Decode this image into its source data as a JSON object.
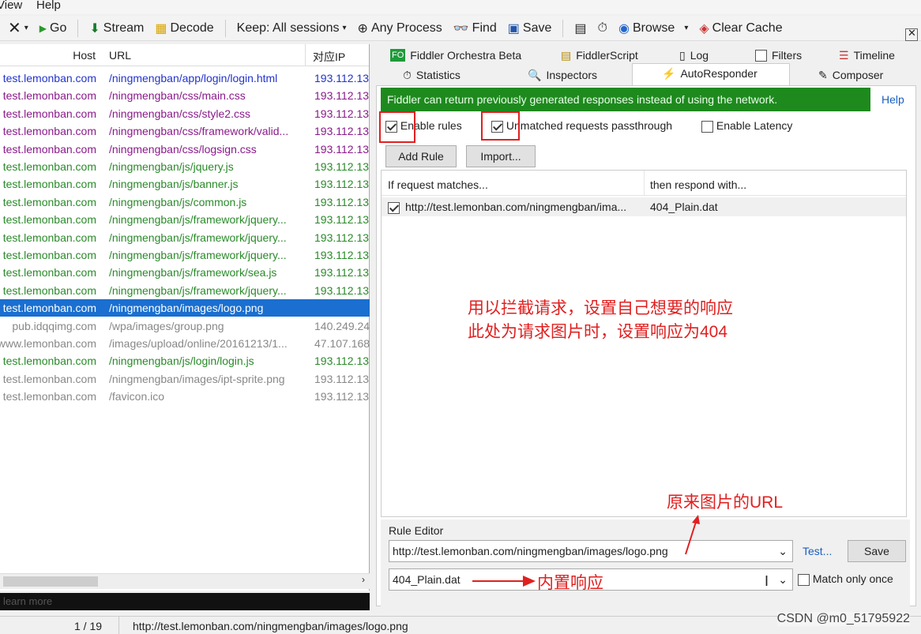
{
  "menu": {
    "view": "View",
    "help": "Help"
  },
  "toolbar": {
    "go": "Go",
    "stream": "Stream",
    "decode": "Decode",
    "keep": "Keep: All sessions",
    "any_process": "Any Process",
    "find": "Find",
    "save": "Save",
    "browse": "Browse",
    "clear_cache": "Clear Cache"
  },
  "sessions": {
    "columns": {
      "host": "Host",
      "url": "URL",
      "ip": "对应IP"
    },
    "rows": [
      {
        "host": "test.lemonban.com",
        "url": "/ningmengban/app/login/login.html",
        "ip": "193.112.13",
        "color": "#2233cc"
      },
      {
        "host": "test.lemonban.com",
        "url": "/ningmengban/css/main.css",
        "ip": "193.112.13",
        "color": "#8a1a8a"
      },
      {
        "host": "test.lemonban.com",
        "url": "/ningmengban/css/style2.css",
        "ip": "193.112.13",
        "color": "#8a1a8a"
      },
      {
        "host": "test.lemonban.com",
        "url": "/ningmengban/css/framework/valid...",
        "ip": "193.112.13",
        "color": "#8a1a8a"
      },
      {
        "host": "test.lemonban.com",
        "url": "/ningmengban/css/logsign.css",
        "ip": "193.112.13",
        "color": "#8a1a8a"
      },
      {
        "host": "test.lemonban.com",
        "url": "/ningmengban/js/jquery.js",
        "ip": "193.112.13",
        "color": "#2a8a2a"
      },
      {
        "host": "test.lemonban.com",
        "url": "/ningmengban/js/banner.js",
        "ip": "193.112.13",
        "color": "#2a8a2a"
      },
      {
        "host": "test.lemonban.com",
        "url": "/ningmengban/js/common.js",
        "ip": "193.112.13",
        "color": "#2a8a2a"
      },
      {
        "host": "test.lemonban.com",
        "url": "/ningmengban/js/framework/jquery...",
        "ip": "193.112.13",
        "color": "#2a8a2a"
      },
      {
        "host": "test.lemonban.com",
        "url": "/ningmengban/js/framework/jquery...",
        "ip": "193.112.13",
        "color": "#2a8a2a"
      },
      {
        "host": "test.lemonban.com",
        "url": "/ningmengban/js/framework/jquery...",
        "ip": "193.112.13",
        "color": "#2a8a2a"
      },
      {
        "host": "test.lemonban.com",
        "url": "/ningmengban/js/framework/sea.js",
        "ip": "193.112.13",
        "color": "#2a8a2a"
      },
      {
        "host": "test.lemonban.com",
        "url": "/ningmengban/js/framework/jquery...",
        "ip": "193.112.13",
        "color": "#2a8a2a"
      },
      {
        "host": "test.lemonban.com",
        "url": "/ningmengban/images/logo.png",
        "ip": "",
        "color": "#ffffff",
        "selected": true
      },
      {
        "host": "pub.idqqimg.com",
        "url": "/wpa/images/group.png",
        "ip": "140.249.24",
        "color": "#888888"
      },
      {
        "host": "www.lemonban.com",
        "url": "/images/upload/online/20161213/1...",
        "ip": "47.107.168",
        "color": "#888888"
      },
      {
        "host": "test.lemonban.com",
        "url": "/ningmengban/js/login/login.js",
        "ip": "193.112.13",
        "color": "#2a8a2a"
      },
      {
        "host": "test.lemonban.com",
        "url": "/ningmengban/images/ipt-sprite.png",
        "ip": "193.112.13",
        "color": "#888888"
      },
      {
        "host": "test.lemonban.com",
        "url": "/favicon.ico",
        "ip": "193.112.13",
        "color": "#888888"
      }
    ]
  },
  "learn_more": "learn more",
  "status": {
    "count": "1 / 19",
    "url": "http://test.lemonban.com/ningmengban/images/logo.png"
  },
  "tabs": {
    "orchestra": "Fiddler Orchestra Beta",
    "script": "FiddlerScript",
    "log": "Log",
    "filters": "Filters",
    "timeline": "Timeline",
    "statistics": "Statistics",
    "inspectors": "Inspectors",
    "autoresponder": "AutoResponder",
    "composer": "Composer"
  },
  "autoresponder": {
    "banner": "Fiddler can return previously generated responses instead of using the network.",
    "help": "Help",
    "enable_rules": "Enable rules",
    "unmatched": "Unmatched requests passthrough",
    "latency": "Enable Latency",
    "add_rule": "Add Rule",
    "import": "Import...",
    "col_match": "If request matches...",
    "col_respond": "then respond with...",
    "rule": {
      "match": "http://test.lemonban.com/ningmengban/ima...",
      "respond": "404_Plain.dat"
    },
    "rule_editor": "Rule Editor",
    "match_value": "http://test.lemonban.com/ningmengban/images/logo.png",
    "respond_value": "404_Plain.dat",
    "test": "Test...",
    "save": "Save",
    "match_once": "Match only once"
  },
  "annotations": {
    "line1": "用以拦截请求，设置自己想要的响应",
    "line2": "此处为请求图片时，设置响应为404",
    "orig_url": "原来图片的URL",
    "builtin": "内置响应"
  },
  "watermark": "CSDN @m0_51795922"
}
